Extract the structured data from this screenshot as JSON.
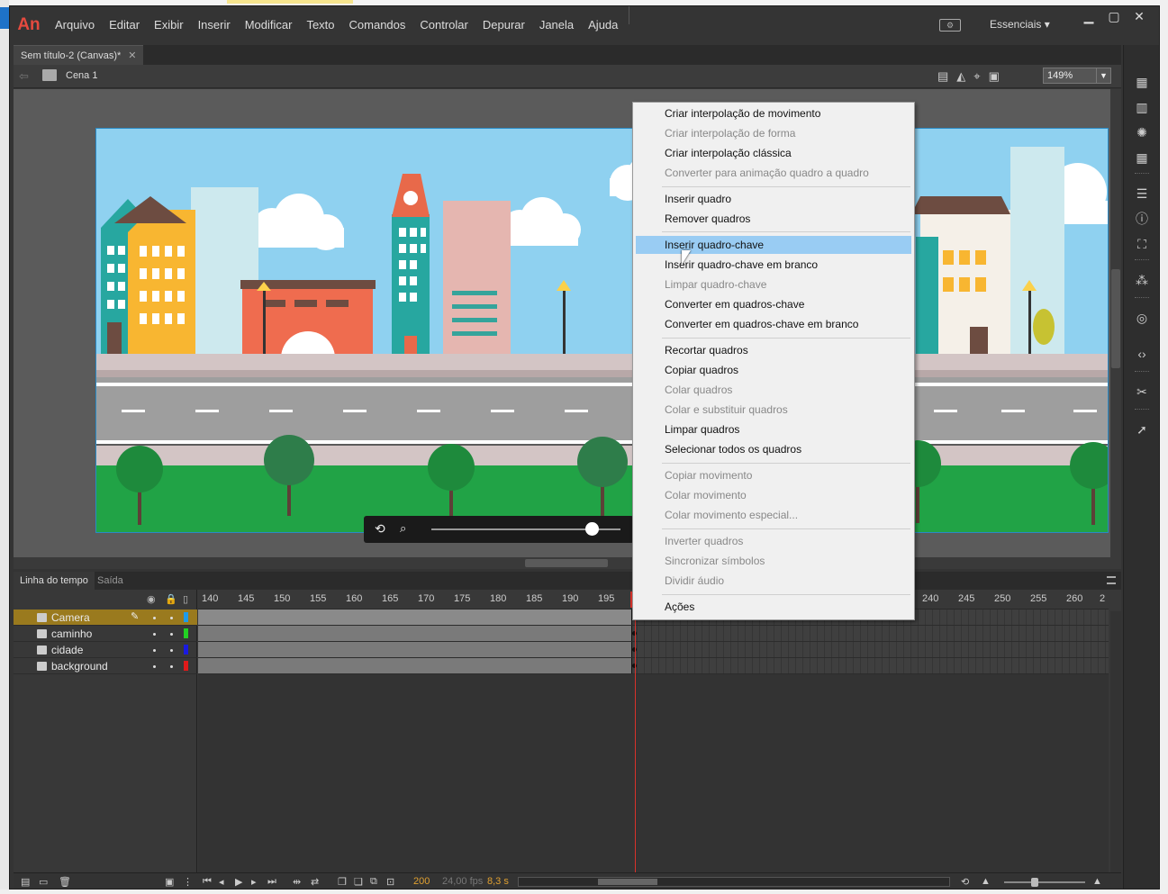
{
  "app": {
    "logo": "An",
    "menu": [
      "Arquivo",
      "Editar",
      "Exibir",
      "Inserir",
      "Modificar",
      "Texto",
      "Comandos",
      "Controlar",
      "Depurar",
      "Janela",
      "Ajuda"
    ],
    "workspace_label": "Essenciais",
    "window_buttons": [
      "minimize",
      "maximize",
      "close"
    ]
  },
  "document": {
    "tab_title": "Sem título-2 (Canvas)*",
    "scene": "Cena 1",
    "zoom": "149%"
  },
  "timeline": {
    "tabs": [
      "Linha do tempo",
      "Saída"
    ],
    "ruler_labels": [
      "140",
      "145",
      "150",
      "155",
      "160",
      "165",
      "170",
      "175",
      "180",
      "185",
      "190",
      "195",
      "240",
      "245",
      "250",
      "255",
      "260",
      "2"
    ],
    "layers": [
      {
        "name": "Camera",
        "color": "#1e9be8",
        "selected": true
      },
      {
        "name": "caminho",
        "color": "#22d122",
        "selected": false
      },
      {
        "name": "cidade",
        "color": "#1a1ae0",
        "selected": false
      },
      {
        "name": "background",
        "color": "#e01a1a",
        "selected": false
      }
    ],
    "current_frame": "200",
    "fps": "24,00 fps",
    "time": "8,3 s"
  },
  "context_menu": {
    "items": [
      {
        "label": "Criar interpolação de movimento",
        "enabled": true
      },
      {
        "label": "Criar interpolação de forma",
        "enabled": false
      },
      {
        "label": "Criar interpolação clássica",
        "enabled": true
      },
      {
        "label": "Converter para animação quadro a quadro",
        "enabled": false
      },
      {
        "label": "Inserir quadro",
        "enabled": true
      },
      {
        "label": "Remover quadros",
        "enabled": true
      },
      {
        "label": "Inserir quadro-chave",
        "enabled": true,
        "highlighted": true
      },
      {
        "label": "Inserir quadro-chave em branco",
        "enabled": true
      },
      {
        "label": "Limpar quadro-chave",
        "enabled": false
      },
      {
        "label": "Converter em quadros-chave",
        "enabled": true
      },
      {
        "label": "Converter em quadros-chave em branco",
        "enabled": true
      },
      {
        "label": "Recortar quadros",
        "enabled": true
      },
      {
        "label": "Copiar quadros",
        "enabled": true
      },
      {
        "label": "Colar quadros",
        "enabled": false
      },
      {
        "label": "Colar e substituir quadros",
        "enabled": false
      },
      {
        "label": "Limpar quadros",
        "enabled": true
      },
      {
        "label": "Selecionar todos os quadros",
        "enabled": true
      },
      {
        "label": "Copiar movimento",
        "enabled": false
      },
      {
        "label": "Colar movimento",
        "enabled": false
      },
      {
        "label": "Colar movimento especial...",
        "enabled": false
      },
      {
        "label": "Inverter quadros",
        "enabled": false
      },
      {
        "label": "Sincronizar símbolos",
        "enabled": false
      },
      {
        "label": "Dividir áudio",
        "enabled": false
      },
      {
        "label": "Ações",
        "enabled": true
      }
    ]
  },
  "colors": {
    "accent_highlight": "#99ccf3",
    "playhead": "#d8322b",
    "selected_layer": "#9a7a1e",
    "logo": "#e54a3f"
  }
}
